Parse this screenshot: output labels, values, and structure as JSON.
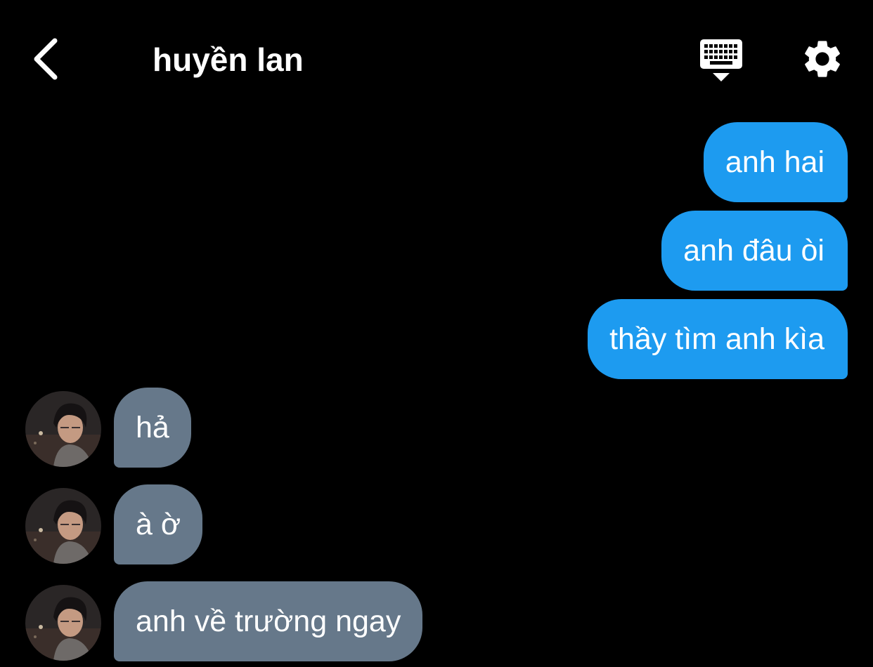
{
  "header": {
    "title": "huyền lan",
    "back_icon": "chevron-left-icon",
    "keyboard_icon": "keyboard-icon",
    "settings_icon": "gear-icon"
  },
  "messages": [
    {
      "direction": "outgoing",
      "text": "anh hai"
    },
    {
      "direction": "outgoing",
      "text": "anh đâu òi"
    },
    {
      "direction": "outgoing",
      "text": "thầy tìm anh kìa"
    },
    {
      "direction": "incoming",
      "text": "hả",
      "avatar": "contact-avatar"
    },
    {
      "direction": "incoming",
      "text": "à ờ",
      "avatar": "contact-avatar"
    },
    {
      "direction": "incoming",
      "text": "anh về trường ngay",
      "avatar": "contact-avatar"
    }
  ],
  "colors": {
    "background": "#000000",
    "outgoing_bubble": "#1d9bf0",
    "incoming_bubble": "#66788a",
    "text": "#ffffff"
  }
}
